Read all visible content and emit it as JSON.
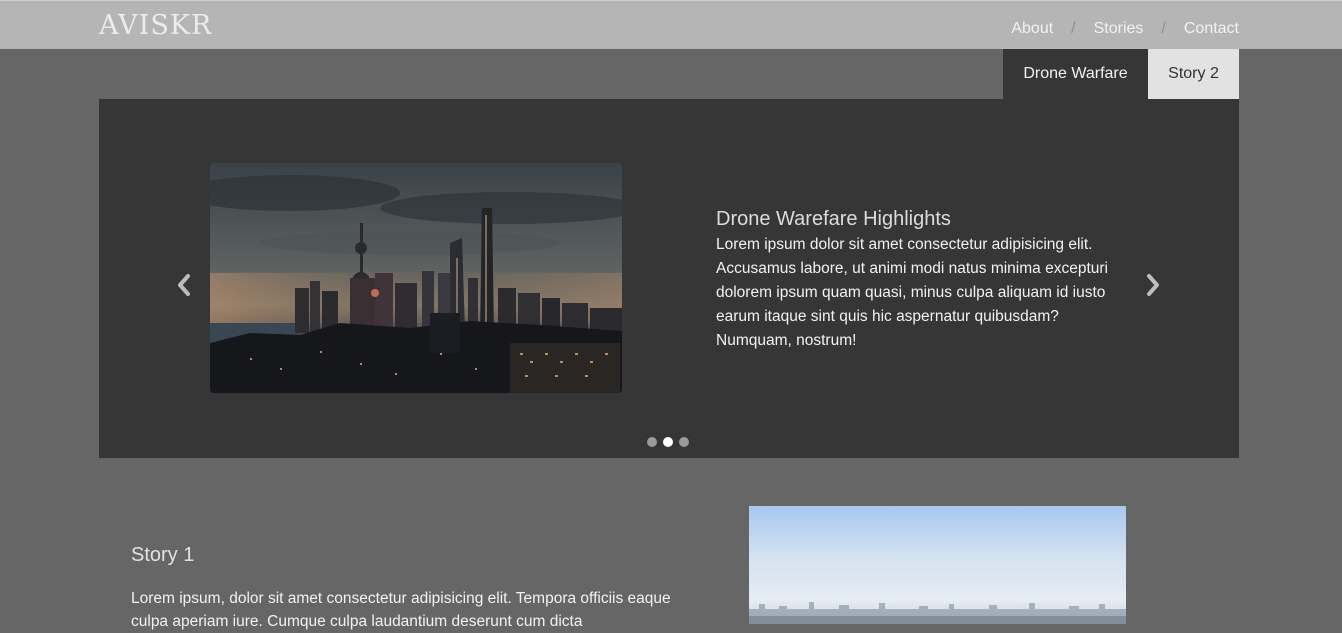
{
  "brand": "AVISKR",
  "nav": {
    "about": "About",
    "stories": "Stories",
    "contact": "Contact",
    "separator": "/"
  },
  "tabs": [
    {
      "label": "Drone Warfare",
      "active": true
    },
    {
      "label": "Story 2",
      "active": false
    }
  ],
  "carousel": {
    "title": "Drone Warefare Highlights",
    "text": "Lorem ipsum dolor sit amet consectetur adipisicing elit. Accusamus labore, ut animi modi natus minima excepturi dolorem ipsum quam quasi, minus culpa aliquam id iusto earum itaque sint quis hic aspernatur quibusdam? Numquam, nostrum!",
    "image": "city-skyline-night-photo",
    "prev_icon": "chevron-left-icon",
    "next_icon": "chevron-right-icon",
    "slide_count": 3,
    "active_slide": 2
  },
  "story": {
    "title": "Story 1",
    "text": "Lorem ipsum, dolor sit amet consectetur adipisicing elit. Tempora officiis eaque culpa aperiam iure. Cumque culpa laudantium deserunt cum dicta",
    "image": "hazy-city-aerial-photo"
  },
  "colors": {
    "page_bg": "#666666",
    "navbar_bg": "#b5b5b5",
    "panel_bg": "#363636",
    "tab_inactive_bg": "#e2e2e2"
  }
}
